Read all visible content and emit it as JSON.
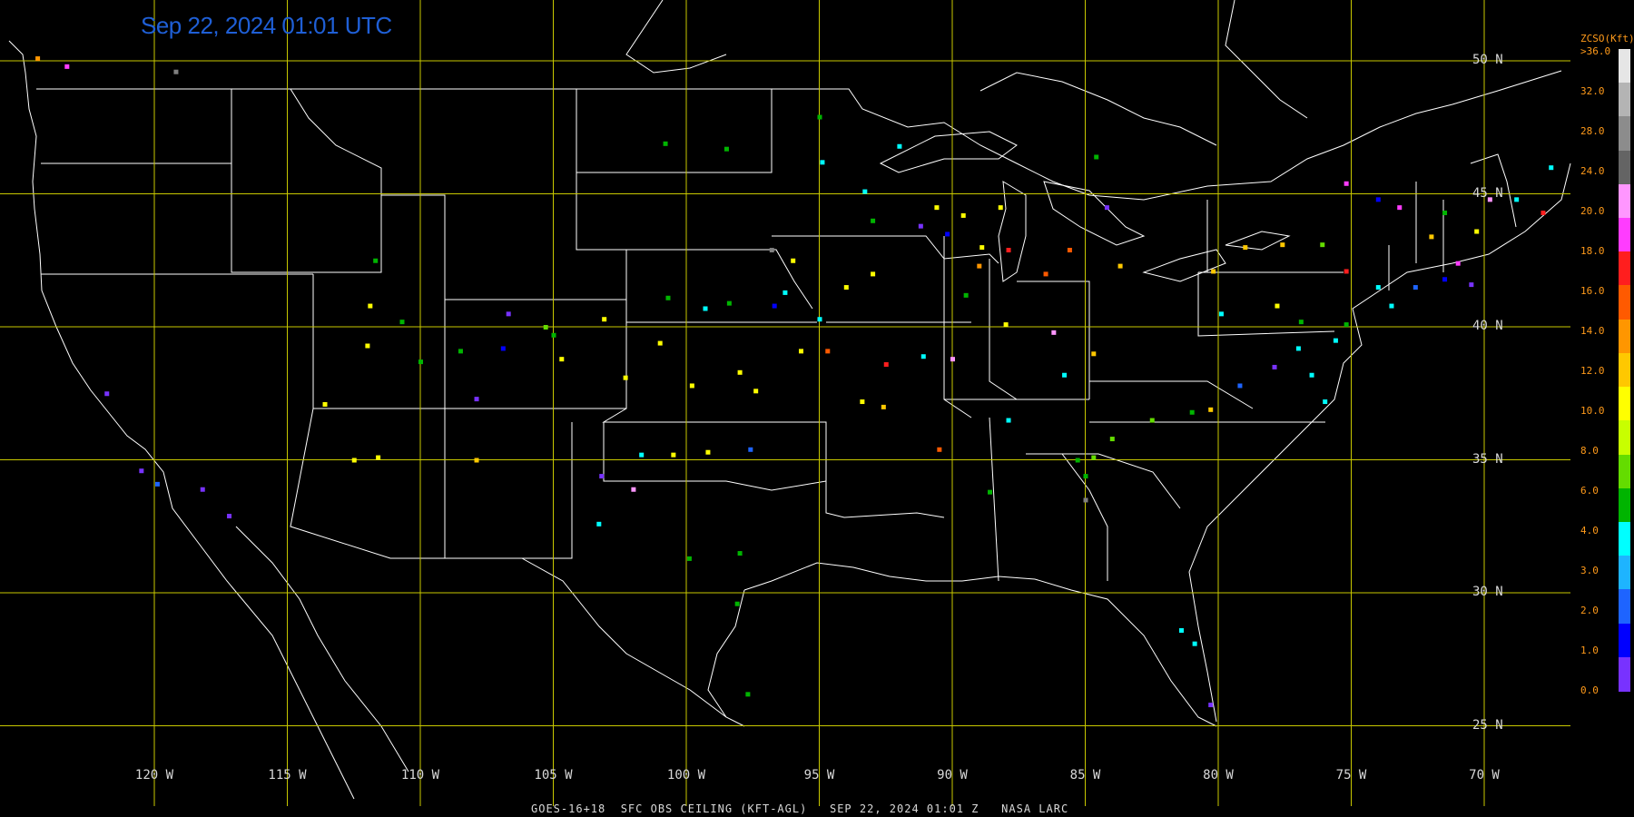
{
  "header": {
    "timestamp": "Sep 22, 2024 01:01 UTC"
  },
  "footer": {
    "caption": "GOES-16+18  SFC OBS CEILING (KFT-AGL)   SEP 22, 2024 01:01 Z   NASA LARC"
  },
  "latitude_labels": [
    "50 N",
    "45 N",
    "40 N",
    "35 N",
    "30 N",
    "25 N"
  ],
  "longitude_labels": [
    "120 W",
    "115 W",
    "110 W",
    "105 W",
    "100 W",
    "95 W",
    "90 W",
    "85 W",
    "80 W",
    "75 W",
    "70 W"
  ],
  "legend": {
    "title": "ZCSO(Kft)",
    "top_label": ">36.0",
    "ticks": [
      "32.0",
      "28.0",
      "24.0",
      "20.0",
      "18.0",
      "16.0",
      "14.0",
      "12.0",
      "10.0",
      "8.0",
      "6.0",
      "4.0",
      "3.0",
      "2.0",
      "1.0",
      "0.0"
    ],
    "colors": [
      "#e6e6e6",
      "#b4b4b4",
      "#8c8c8c",
      "#646464",
      "#ff96ff",
      "#ff3cff",
      "#ff1e1e",
      "#ff5a00",
      "#ff9600",
      "#ffc800",
      "#ffff00",
      "#c8ff00",
      "#64dc00",
      "#00b400",
      "#00ffff",
      "#1eb4ff",
      "#1e64ff",
      "#0000ff",
      "#7832ff"
    ]
  },
  "colors": {
    "grid": "#c8c800",
    "border": "#ffffff",
    "background": "#000000"
  },
  "observations": [
    {
      "lon": -98.5,
      "lat": 46.7,
      "c": "#00b400"
    },
    {
      "lon": -95.0,
      "lat": 47.9,
      "c": "#00b400"
    },
    {
      "lon": -94.9,
      "lat": 46.2,
      "c": "#00ffff"
    },
    {
      "lon": -93.3,
      "lat": 45.1,
      "c": "#00ffff"
    },
    {
      "lon": -93.0,
      "lat": 44.0,
      "c": "#00b400"
    },
    {
      "lon": -92.0,
      "lat": 46.8,
      "c": "#00ffff"
    },
    {
      "lon": -90.6,
      "lat": 44.5,
      "c": "#ffff00"
    },
    {
      "lon": -89.6,
      "lat": 44.2,
      "c": "#ffff00"
    },
    {
      "lon": -88.9,
      "lat": 43.0,
      "c": "#ffff00"
    },
    {
      "lon": -88.2,
      "lat": 44.5,
      "c": "#ffff00"
    },
    {
      "lon": -90.2,
      "lat": 43.5,
      "c": "#0000ff"
    },
    {
      "lon": -91.2,
      "lat": 43.8,
      "c": "#7832ff"
    },
    {
      "lon": -89.0,
      "lat": 42.3,
      "c": "#ff9600"
    },
    {
      "lon": -87.9,
      "lat": 42.9,
      "c": "#ff1e1e"
    },
    {
      "lon": -86.5,
      "lat": 42.0,
      "c": "#ff5a00"
    },
    {
      "lon": -85.6,
      "lat": 42.9,
      "c": "#ff5a00"
    },
    {
      "lon": -84.2,
      "lat": 44.5,
      "c": "#7832ff"
    },
    {
      "lon": -83.7,
      "lat": 42.3,
      "c": "#ffc800"
    },
    {
      "lon": -84.6,
      "lat": 46.4,
      "c": "#00b400"
    },
    {
      "lon": -96.3,
      "lat": 41.3,
      "c": "#00ffff"
    },
    {
      "lon": -96.0,
      "lat": 42.5,
      "c": "#ffff00"
    },
    {
      "lon": -94.0,
      "lat": 41.5,
      "c": "#ffff00"
    },
    {
      "lon": -93.0,
      "lat": 42.0,
      "c": "#ffff00"
    },
    {
      "lon": -95.0,
      "lat": 40.3,
      "c": "#00ffff"
    },
    {
      "lon": -94.7,
      "lat": 39.1,
      "c": "#ff5a00"
    },
    {
      "lon": -92.5,
      "lat": 38.6,
      "c": "#ff1e1e"
    },
    {
      "lon": -91.1,
      "lat": 38.9,
      "c": "#00ffff"
    },
    {
      "lon": -90.0,
      "lat": 38.8,
      "c": "#ff96ff"
    },
    {
      "lon": -89.5,
      "lat": 41.2,
      "c": "#00b400"
    },
    {
      "lon": -88.0,
      "lat": 40.1,
      "c": "#ffff00"
    },
    {
      "lon": -86.2,
      "lat": 39.8,
      "c": "#ff96ff"
    },
    {
      "lon": -85.8,
      "lat": 38.2,
      "c": "#00ffff"
    },
    {
      "lon": -84.7,
      "lat": 39.0,
      "c": "#ffc800"
    },
    {
      "lon": -93.4,
      "lat": 37.2,
      "c": "#ffff00"
    },
    {
      "lon": -92.6,
      "lat": 37.0,
      "c": "#ffc800"
    },
    {
      "lon": -90.5,
      "lat": 35.4,
      "c": "#ff5a00"
    },
    {
      "lon": -88.6,
      "lat": 33.8,
      "c": "#00b400"
    },
    {
      "lon": -87.9,
      "lat": 36.5,
      "c": "#00ffff"
    },
    {
      "lon": -85.3,
      "lat": 35.0,
      "c": "#00b400"
    },
    {
      "lon": -84.7,
      "lat": 35.1,
      "c": "#64dc00"
    },
    {
      "lon": -84.0,
      "lat": 35.8,
      "c": "#64dc00"
    },
    {
      "lon": -85.0,
      "lat": 34.4,
      "c": "#00b400"
    },
    {
      "lon": -85.0,
      "lat": 33.5,
      "c": "#808080"
    },
    {
      "lon": -82.5,
      "lat": 36.5,
      "c": "#64dc00"
    },
    {
      "lon": -81.0,
      "lat": 36.8,
      "c": "#00b400"
    },
    {
      "lon": -80.3,
      "lat": 36.9,
      "c": "#ffc800"
    },
    {
      "lon": -79.2,
      "lat": 37.8,
      "c": "#1e64ff"
    },
    {
      "lon": -77.9,
      "lat": 38.5,
      "c": "#7832ff"
    },
    {
      "lon": -77.0,
      "lat": 39.2,
      "c": "#00ffff"
    },
    {
      "lon": -76.5,
      "lat": 38.2,
      "c": "#00ffff"
    },
    {
      "lon": -76.0,
      "lat": 37.2,
      "c": "#00ffff"
    },
    {
      "lon": -75.6,
      "lat": 39.5,
      "c": "#00ffff"
    },
    {
      "lon": -75.2,
      "lat": 40.1,
      "c": "#00b400"
    },
    {
      "lon": -76.9,
      "lat": 40.2,
      "c": "#00b400"
    },
    {
      "lon": -77.8,
      "lat": 40.8,
      "c": "#ffff00"
    },
    {
      "lon": -79.9,
      "lat": 40.5,
      "c": "#00ffff"
    },
    {
      "lon": -80.2,
      "lat": 42.1,
      "c": "#ffc800"
    },
    {
      "lon": -79.0,
      "lat": 43.0,
      "c": "#ffc800"
    },
    {
      "lon": -77.6,
      "lat": 43.1,
      "c": "#ffc800"
    },
    {
      "lon": -76.1,
      "lat": 43.1,
      "c": "#64dc00"
    },
    {
      "lon": -75.2,
      "lat": 42.1,
      "c": "#ff1e1e"
    },
    {
      "lon": -74.0,
      "lat": 41.5,
      "c": "#00ffff"
    },
    {
      "lon": -73.5,
      "lat": 40.8,
      "c": "#00ffff"
    },
    {
      "lon": -72.6,
      "lat": 41.5,
      "c": "#1e64ff"
    },
    {
      "lon": -71.5,
      "lat": 41.8,
      "c": "#0000ff"
    },
    {
      "lon": -71.0,
      "lat": 42.4,
      "c": "#ff3cff"
    },
    {
      "lon": -70.5,
      "lat": 41.6,
      "c": "#7832ff"
    },
    {
      "lon": -72.0,
      "lat": 43.4,
      "c": "#ffc800"
    },
    {
      "lon": -71.5,
      "lat": 44.3,
      "c": "#00b400"
    },
    {
      "lon": -70.3,
      "lat": 43.6,
      "c": "#ffff00"
    },
    {
      "lon": -69.8,
      "lat": 44.8,
      "c": "#ff96ff"
    },
    {
      "lon": -68.8,
      "lat": 44.8,
      "c": "#00ffff"
    },
    {
      "lon": -73.2,
      "lat": 44.5,
      "c": "#ff3cff"
    },
    {
      "lon": -74.0,
      "lat": 44.8,
      "c": "#0000ff"
    },
    {
      "lon": -67.5,
      "lat": 46.0,
      "c": "#00ffff"
    },
    {
      "lon": -67.8,
      "lat": 44.3,
      "c": "#ff1e1e"
    },
    {
      "lon": -75.2,
      "lat": 45.4,
      "c": "#ff3cff"
    },
    {
      "lon": -81.4,
      "lat": 28.6,
      "c": "#00ffff"
    },
    {
      "lon": -80.9,
      "lat": 28.1,
      "c": "#00ffff"
    },
    {
      "lon": -80.3,
      "lat": 25.8,
      "c": "#7832ff"
    },
    {
      "lon": -105.0,
      "lat": 39.7,
      "c": "#00b400"
    },
    {
      "lon": -104.7,
      "lat": 38.8,
      "c": "#ffff00"
    },
    {
      "lon": -105.3,
      "lat": 40.0,
      "c": "#64dc00"
    },
    {
      "lon": -106.9,
      "lat": 39.2,
      "c": "#0000ff"
    },
    {
      "lon": -107.9,
      "lat": 37.3,
      "c": "#7832ff"
    },
    {
      "lon": -106.7,
      "lat": 40.5,
      "c": "#7832ff"
    },
    {
      "lon": -108.5,
      "lat": 39.1,
      "c": "#00b400"
    },
    {
      "lon": -103.1,
      "lat": 40.3,
      "c": "#ffff00"
    },
    {
      "lon": -102.3,
      "lat": 38.1,
      "c": "#ffff00"
    },
    {
      "lon": -100.7,
      "lat": 41.1,
      "c": "#00b400"
    },
    {
      "lon": -99.3,
      "lat": 40.7,
      "c": "#00ffff"
    },
    {
      "lon": -98.4,
      "lat": 40.9,
      "c": "#00b400"
    },
    {
      "lon": -97.4,
      "lat": 37.6,
      "c": "#ffff00"
    },
    {
      "lon": -98.0,
      "lat": 38.3,
      "c": "#ffff00"
    },
    {
      "lon": -99.8,
      "lat": 37.8,
      "c": "#ffff00"
    },
    {
      "lon": -101.0,
      "lat": 39.4,
      "c": "#ffff00"
    },
    {
      "lon": -95.7,
      "lat": 39.1,
      "c": "#ffff00"
    },
    {
      "lon": -96.7,
      "lat": 40.8,
      "c": "#0000ff"
    },
    {
      "lon": -100.5,
      "lat": 35.2,
      "c": "#ffff00"
    },
    {
      "lon": -99.2,
      "lat": 35.3,
      "c": "#ffff00"
    },
    {
      "lon": -97.6,
      "lat": 35.4,
      "c": "#1e64ff"
    },
    {
      "lon": -101.7,
      "lat": 35.2,
      "c": "#00ffff"
    },
    {
      "lon": -102.0,
      "lat": 33.9,
      "c": "#ff96ff"
    },
    {
      "lon": -103.2,
      "lat": 34.4,
      "c": "#7832ff"
    },
    {
      "lon": -103.3,
      "lat": 32.6,
      "c": "#00ffff"
    },
    {
      "lon": -99.9,
      "lat": 31.3,
      "c": "#00b400"
    },
    {
      "lon": -98.0,
      "lat": 31.5,
      "c": "#00b400"
    },
    {
      "lon": -98.1,
      "lat": 29.6,
      "c": "#00b400"
    },
    {
      "lon": -97.7,
      "lat": 26.2,
      "c": "#00b400"
    },
    {
      "lon": -111.9,
      "lat": 40.8,
      "c": "#ffff00"
    },
    {
      "lon": -112.0,
      "lat": 39.3,
      "c": "#ffff00"
    },
    {
      "lon": -113.6,
      "lat": 37.1,
      "c": "#ffff00"
    },
    {
      "lon": -110.7,
      "lat": 40.2,
      "c": "#00b400"
    },
    {
      "lon": -110.0,
      "lat": 38.7,
      "c": "#00b400"
    },
    {
      "lon": -112.5,
      "lat": 35.0,
      "c": "#ffff00"
    },
    {
      "lon": -111.6,
      "lat": 35.1,
      "c": "#ffff00"
    },
    {
      "lon": -107.9,
      "lat": 35.0,
      "c": "#ffc800"
    },
    {
      "lon": -111.7,
      "lat": 42.5,
      "c": "#00b400"
    },
    {
      "lon": -120.5,
      "lat": 34.6,
      "c": "#7832ff"
    },
    {
      "lon": -119.9,
      "lat": 34.1,
      "c": "#1e64ff"
    },
    {
      "lon": -118.2,
      "lat": 33.9,
      "c": "#7832ff"
    },
    {
      "lon": -117.2,
      "lat": 32.9,
      "c": "#7832ff"
    },
    {
      "lon": -121.8,
      "lat": 37.5,
      "c": "#7832ff"
    },
    {
      "lon": -124.4,
      "lat": 50.1,
      "c": "#ff9600"
    },
    {
      "lon": -123.3,
      "lat": 49.8,
      "c": "#ff3cff"
    },
    {
      "lon": -119.2,
      "lat": 49.6,
      "c": "#808080"
    },
    {
      "lon": -100.8,
      "lat": 46.9,
      "c": "#00b400"
    },
    {
      "lon": -96.8,
      "lat": 42.9,
      "c": "#808080"
    }
  ]
}
